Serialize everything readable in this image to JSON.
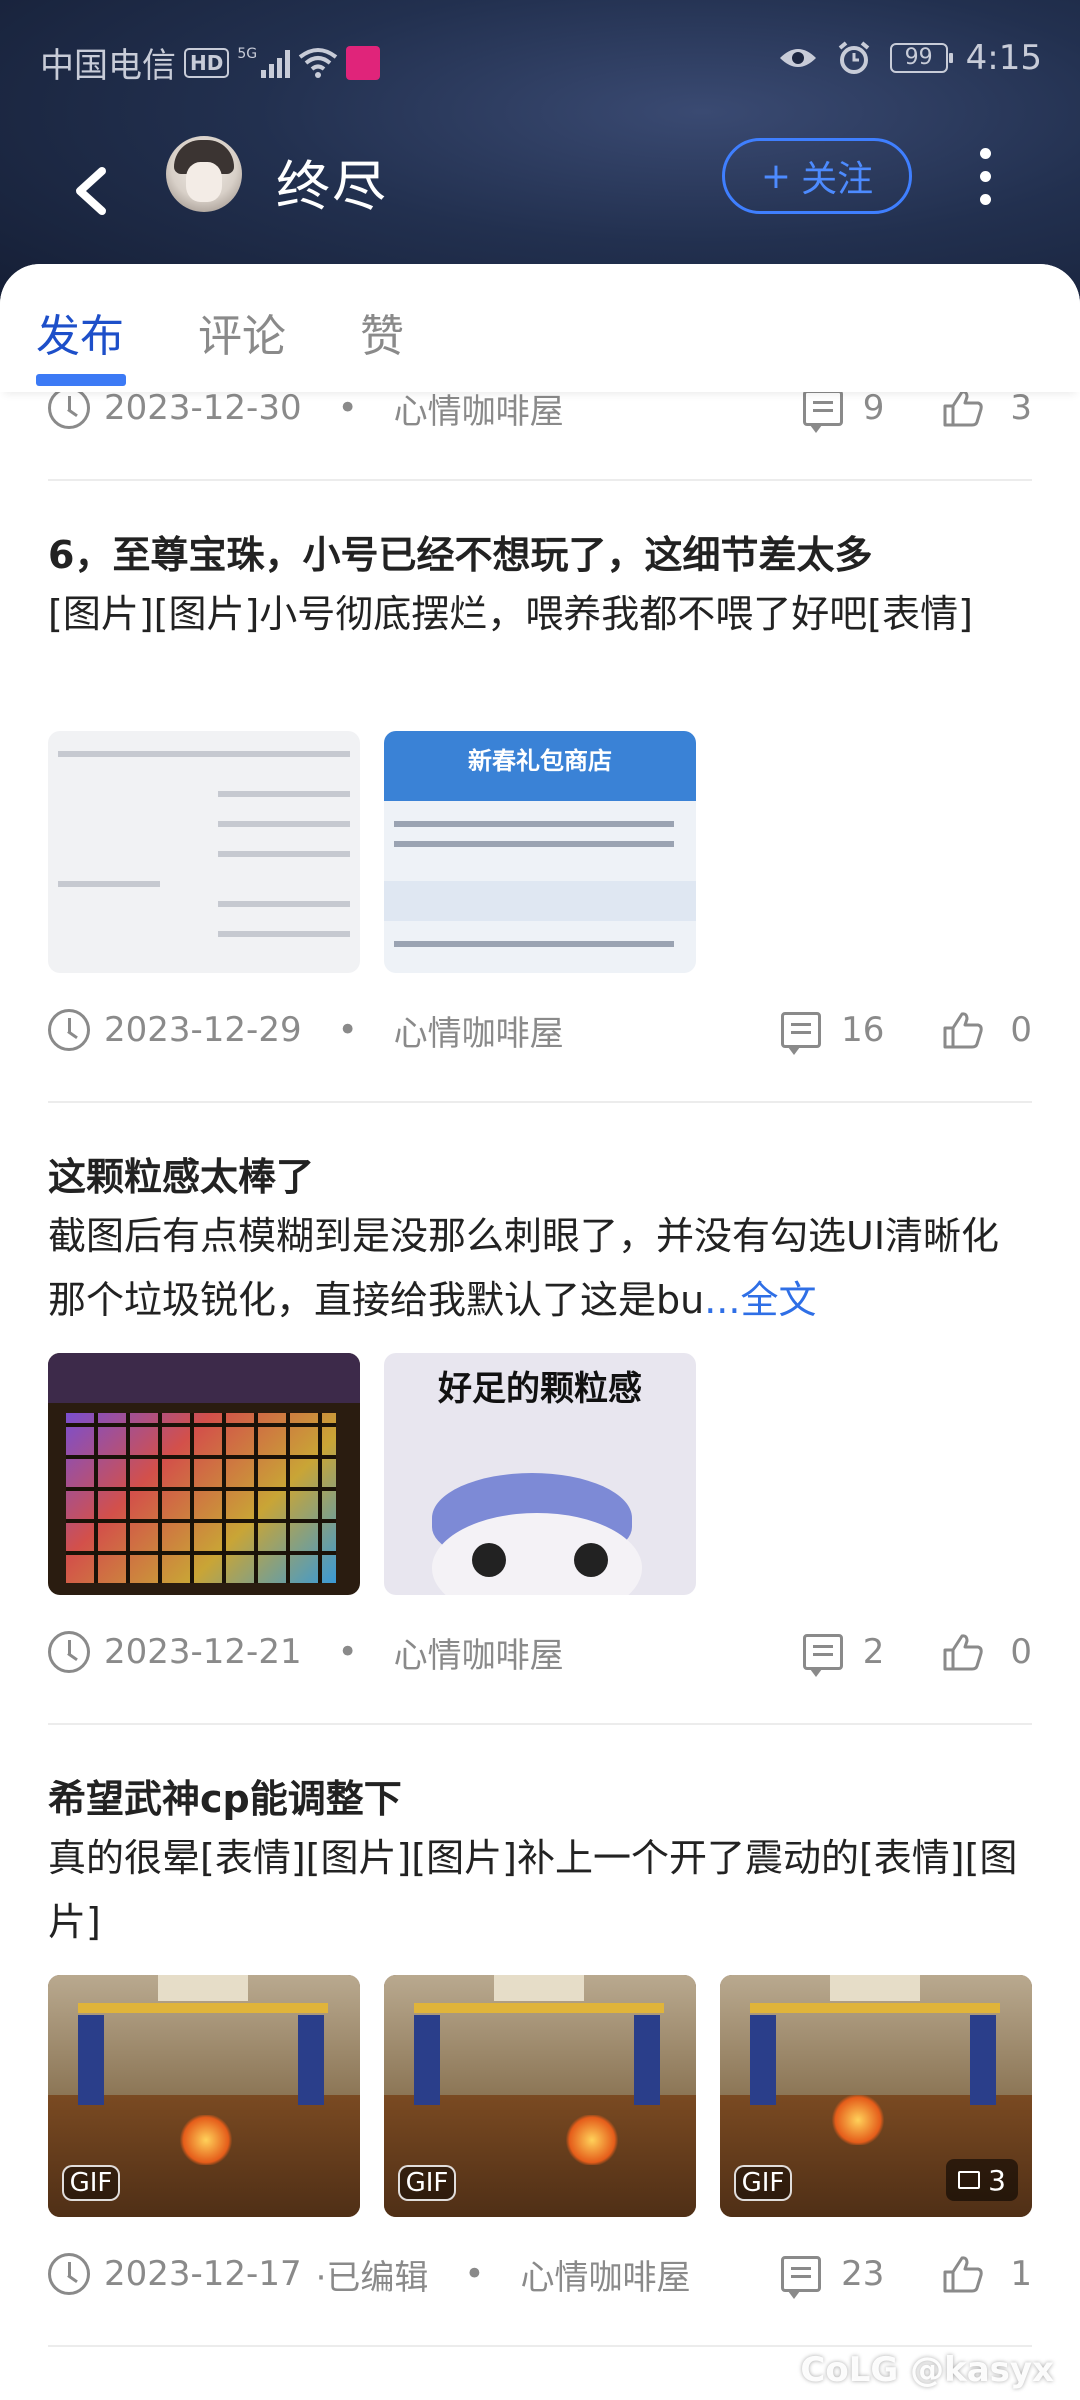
{
  "status_bar": {
    "carrier": "中国电信",
    "hd": "HD",
    "network": "5G",
    "battery": "99",
    "time": "4:15"
  },
  "header": {
    "username": "终尽",
    "follow_label": "关注",
    "follow_plus": "+"
  },
  "tabs": [
    {
      "label": "发布",
      "active": true
    },
    {
      "label": "评论",
      "active": false
    },
    {
      "label": "赞",
      "active": false
    }
  ],
  "posts": [
    {
      "date": "2023-12-30",
      "circle": "心情咖啡屋",
      "comments": "9",
      "likes": "3"
    },
    {
      "title": "6，至尊宝珠，小号已经不想玩了，这细节差太多",
      "body": "[图片][图片]小号彻底摆烂，喂养我都不喂了好吧[表情]",
      "images": [
        "table-screenshot",
        "gift-shop-screenshot"
      ],
      "image_text": {
        "shop_title": "新春礼包商店"
      },
      "date": "2023-12-29",
      "circle": "心情咖啡屋",
      "comments": "16",
      "likes": "0"
    },
    {
      "title": "这颗粒感太棒了",
      "body": "截图后有点模糊到是没那么刺眼了，并没有勾选UI清晰化那个垃圾锐化，直接给我默认了这是bu",
      "more": "...全文",
      "images": [
        "game-inventory-screenshot",
        "meme-image"
      ],
      "image_text": {
        "meme_caption": "好足的颗粒感"
      },
      "date": "2023-12-21",
      "circle": "心情咖啡屋",
      "comments": "2",
      "likes": "0"
    },
    {
      "title": "希望武神cp能调整下",
      "body": " 真的很晕[表情][图片][图片]补上一个开了震动的[表情][图片]",
      "images": [
        "gif-1",
        "gif-2",
        "gif-3"
      ],
      "gif_label": "GIF",
      "extra_count": "3",
      "date": "2023-12-17",
      "edited": "·已编辑",
      "circle": "心情咖啡屋",
      "comments": "23",
      "likes": "1"
    }
  ],
  "watermark": "CoLG @kasyx"
}
